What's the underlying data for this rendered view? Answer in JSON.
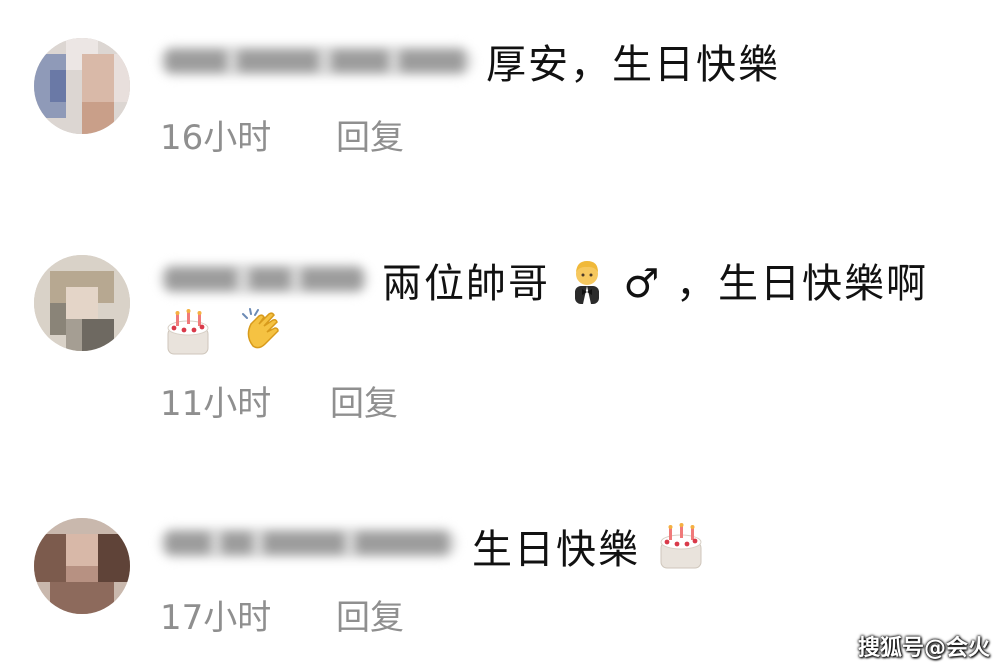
{
  "comments": [
    {
      "text": "厚安，生日快樂",
      "time": "16小时",
      "reply_label": "回复"
    },
    {
      "text_line1": "兩位帥哥",
      "text_line1_after": "♂ ，生日快樂啊",
      "time": "11小时",
      "reply_label": "回复"
    },
    {
      "text": "生日快樂",
      "time": "17小时",
      "reply_label": "回复"
    }
  ],
  "watermark": "搜狐号@会火",
  "icons": [
    "person-in-tuxedo-icon",
    "birthday-cake-icon",
    "clapping-hands-icon"
  ]
}
